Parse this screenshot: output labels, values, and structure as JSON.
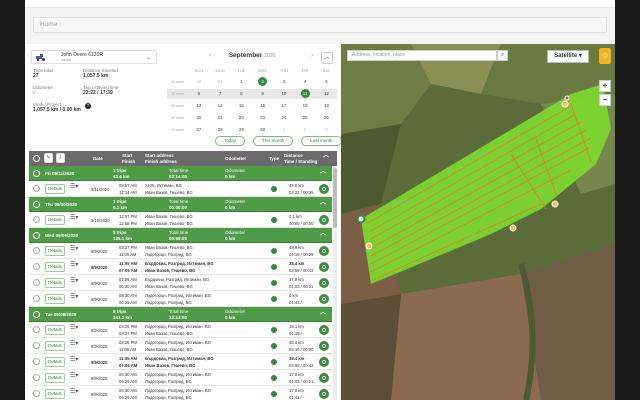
{
  "breadcrumb": "Home",
  "vehicle": {
    "name": "John Deere 6120R",
    "sub": "tractor"
  },
  "stats": {
    "trips_total_label": "Trips total",
    "trips_total": "27",
    "distance_label": "Distance traveled",
    "distance": "1,057.5 km",
    "odometer_label": "Odometer",
    "odometer": "-",
    "trip_time_label": "Trip / staying time",
    "trip_time": "22:22 / 17:39",
    "work_label": "Work / Project",
    "work": "1,057.5 km / 0.00 km"
  },
  "calendar": {
    "month": "September",
    "year": "2020",
    "days": [
      "SUN",
      "MON",
      "TUE",
      "WED",
      "THU",
      "FRI",
      "SAT"
    ],
    "weeks": [
      {
        "wk": "36 week",
        "d": [
          "30",
          "31",
          "1",
          "2",
          "3",
          "4",
          "5"
        ]
      },
      {
        "wk": "37 week",
        "d": [
          "6",
          "7",
          "8",
          "9",
          "10",
          "11",
          "12"
        ]
      },
      {
        "wk": "38 week",
        "d": [
          "13",
          "14",
          "15",
          "16",
          "17",
          "18",
          "19"
        ]
      },
      {
        "wk": "39 week",
        "d": [
          "20",
          "21",
          "22",
          "23",
          "24",
          "25",
          "26"
        ]
      },
      {
        "wk": "40 week",
        "d": [
          "27",
          "28",
          "29",
          "30",
          "1",
          "2",
          "3"
        ]
      }
    ],
    "btn_today": "Today",
    "btn_month": "This month",
    "btn_last": "Last month"
  },
  "table": {
    "headers": {
      "date": "Date",
      "start": "Start",
      "finish": "Finish",
      "start_addr": "Start address",
      "finish_addr": "Finish address",
      "odometer": "Odometer",
      "type": "Type",
      "distance": "Distance",
      "time_standing": "Time / Standing"
    }
  },
  "groups": [
    {
      "date": "Fri 09/11/2020",
      "trips": "1 trips",
      "dist": "43.4 km",
      "time_label": "Total time",
      "time": "02:14:00",
      "odo": "Odometer",
      "odo_val": "0 km",
      "rows": [
        {
          "date": "9/11/2020",
          "start": "09:57 AM",
          "finish": "12:14 AM",
          "saddr": "2105, Ихтиман, BG",
          "faddr": "Иван Вазов, Гешево, BG",
          "dist": "43.6 km",
          "time": "02:23 / 00:35",
          "bold": false
        }
      ]
    },
    {
      "date": "Thu 09/10/2020",
      "trips": "1 trips",
      "dist": "0.1 km",
      "time_label": "Total time",
      "time": "00:00:00",
      "odo": "Odometer",
      "odo_val": "0 km",
      "rows": [
        {
          "date": "9/10/2020",
          "start": "12:57 PM",
          "finish": "12:58 PM",
          "saddr": "Иван Вазов, Гешево, BG",
          "faddr": "Иван Вазов, Гешево, BG",
          "dist": "0.1 km",
          "time": "00:00 / 00:00",
          "bold": false
        }
      ]
    },
    {
      "date": "Wed 09/09/2020",
      "trips": "5 trips",
      "dist": "125.1 km",
      "time_label": "Total time",
      "time": "09:59:00",
      "odo": "Odometer",
      "odo_val": "0 km",
      "rows": [
        {
          "date": "9/9/2020",
          "start": "03:27 PM",
          "finish": "11:05 AM",
          "saddr": "Иван Вазов, Гешево, BG",
          "faddr": "Лодогорци, Разгрид, BG",
          "dist": "48.8 km",
          "time": "04:19 / 00:29",
          "bold": false
        },
        {
          "date": "9/9/2020",
          "start": "11:05 AM",
          "finish": "07:06 AM",
          "saddr": "Бърдокиа, Разгрид, Ихтиман, BG",
          "faddr": "Иван Вазов, Гешево, BG",
          "dist": "38.4 km",
          "time": "03:59 / 00:42",
          "bold": true
        },
        {
          "date": "9/9/2020",
          "start": "07:06 AM",
          "finish": "06:30 AM",
          "saddr": "Бърдокиа, Разгрид, Ихтиман, BG",
          "faddr": "Иван Вазов, Гешево, BG",
          "dist": "17.9 km",
          "time": "01:03 / 00:21",
          "bold": false
        },
        {
          "date": "9/9/2020",
          "start": "06:30 AM",
          "finish": "06:29 AM",
          "saddr": "Лодогорци, Разгрид, Ихтиман, BG",
          "faddr": "Лодогорци, Разгрид, BG",
          "dist": "0 km",
          "time": "01:41 / -",
          "bold": false
        }
      ]
    },
    {
      "date": "Tue 09/08/2020",
      "trips": "5 trips",
      "dist": "241.2 km",
      "time_label": "Total time",
      "time": "23:13:00",
      "odo": "Odometer",
      "odo_val": "0 km",
      "rows": [
        {
          "date": "8/9/2020",
          "start": "03:25 PM",
          "finish": "03:27 PM",
          "saddr": "Лодогорци, Разгрид, Ихтиман, BG",
          "faddr": "Иван Вазов, Гешево, BG",
          "dist": "18.1 km",
          "time": "01:19 / -",
          "bold": false
        },
        {
          "date": "8/9/2020",
          "start": "02:25 PM",
          "finish": "11:05 AM",
          "saddr": "Лодогорци, Разгрид, Ихтиман, BG",
          "faddr": "Иван Вазов, Гешево, BG",
          "dist": "48.4 km",
          "time": "04:19 / 00:00",
          "bold": false
        },
        {
          "date": "9/9/2020",
          "start": "11:05 AM",
          "finish": "07:06 AM",
          "saddr": "Бърдокиа, Разгрид, Ихтиман, BG",
          "faddr": "Иван Вазов, Гешево, BG",
          "dist": "38.4 km",
          "time": "03:59 / 00:42",
          "bold": true
        },
        {
          "date": "9/9/2020",
          "start": "06:30 AM",
          "finish": "06:29 AM",
          "saddr": "Лодогорци, Разгрид, Ихтиман, BG",
          "faddr": "Лодогорци, Разгрид, BG",
          "dist": "17.9 km",
          "time": "01:03 / 00:21",
          "bold": false
        },
        {
          "date": "9/9/2020",
          "start": "06:30 AM",
          "finish": "06:29 AM",
          "saddr": "Лодогорци, Разгрид, Ихтиман, BG",
          "faddr": "Лодогорци, Разгрид, BG",
          "dist": "17.9 km",
          "time": "01:41 / -",
          "bold": false
        }
      ]
    }
  ],
  "row_labels": {
    "details": "Details"
  },
  "map": {
    "search_placeholder": "Address, location, place",
    "type": "Satellite"
  },
  "colors": {
    "accent_green": "#4f9b47",
    "track_green": "#7bd62f",
    "track_orange": "#e07a2a",
    "header_grey": "#6b6b6b"
  },
  "icons": {
    "vehicle": "tractor-icon",
    "search": "search-icon",
    "pegman": "street-view-icon",
    "target": "target-icon"
  }
}
